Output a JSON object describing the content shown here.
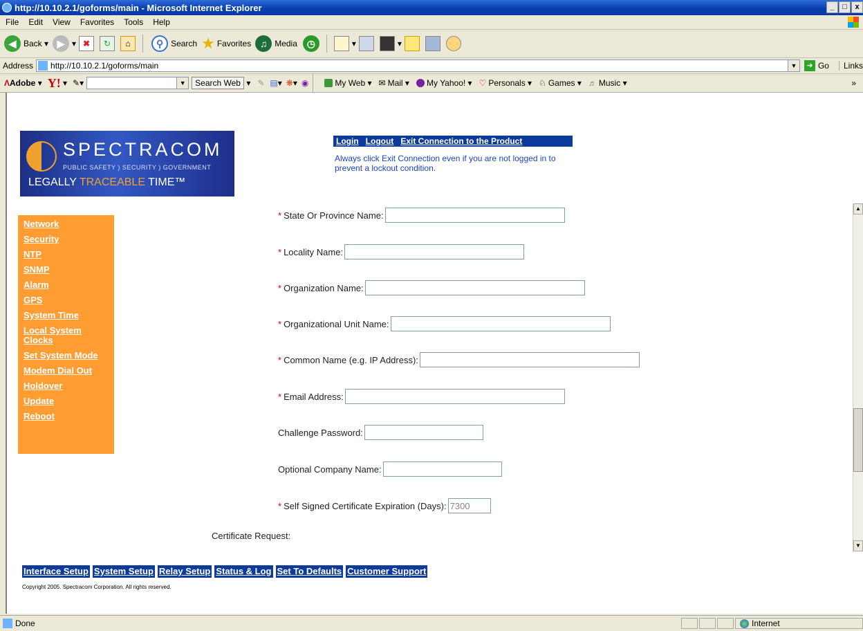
{
  "window": {
    "title": "http://10.10.2.1/goforms/main - Microsoft Internet Explorer",
    "min": "_",
    "max": "□",
    "close": "x"
  },
  "menu": [
    "File",
    "Edit",
    "View",
    "Favorites",
    "Tools",
    "Help"
  ],
  "toolbar": {
    "back": "Back",
    "search": "Search",
    "favorites": "Favorites",
    "media": "Media"
  },
  "address": {
    "label": "Address",
    "url": "http://10.10.2.1/goforms/main",
    "go": "Go",
    "links": "Links"
  },
  "yahoo": {
    "adobe": "Adobe",
    "search_web": "Search Web",
    "my_web": "My Web",
    "mail": "Mail",
    "my_yahoo": "My Yahoo!",
    "personals": "Personals",
    "games": "Games",
    "music": "Music"
  },
  "logo": {
    "brand": "SPECTRACOM",
    "tagline": "PUBLIC SAFETY ) SECURITY ) GOVERNMENT",
    "slogan_a": "LEGALLY ",
    "slogan_b": "TRACEABLE",
    "slogan_c": " TIME™"
  },
  "topnav": {
    "login": "Login",
    "logout": "Logout",
    "exit": "Exit Connection to the Product"
  },
  "notice": "Always click Exit Connection even if you are not logged in to prevent a lockout condition.",
  "sidemenu": [
    "Network",
    "Security",
    "NTP",
    "SNMP",
    "Alarm",
    "GPS",
    "System Time",
    "Local System Clocks",
    "Set System Mode",
    "Modem Dial Out",
    "Holdover",
    "Update",
    "Reboot"
  ],
  "form": {
    "required_mark": "*",
    "state": "State Or Province Name:",
    "locality": "Locality Name:",
    "organization": "Organization Name:",
    "org_unit": "Organizational Unit Name:",
    "common_name": "Common Name (e.g. IP Address):",
    "email": "Email Address:",
    "challenge": "Challenge Password:",
    "company": "Optional Company Name:",
    "expiration": "Self Signed Certificate Expiration (Days):",
    "expiration_value": "7300"
  },
  "cert_request": "Certificate Request:",
  "bottomnav": [
    "Interface Setup",
    "System Setup",
    "Relay Setup",
    "Status & Log",
    "Set To Defaults",
    "Customer Support"
  ],
  "copyright": "Copyright 2005. Spectracom Corporation. All rights reserved.",
  "status": {
    "left": "Done",
    "zone": "Internet"
  }
}
